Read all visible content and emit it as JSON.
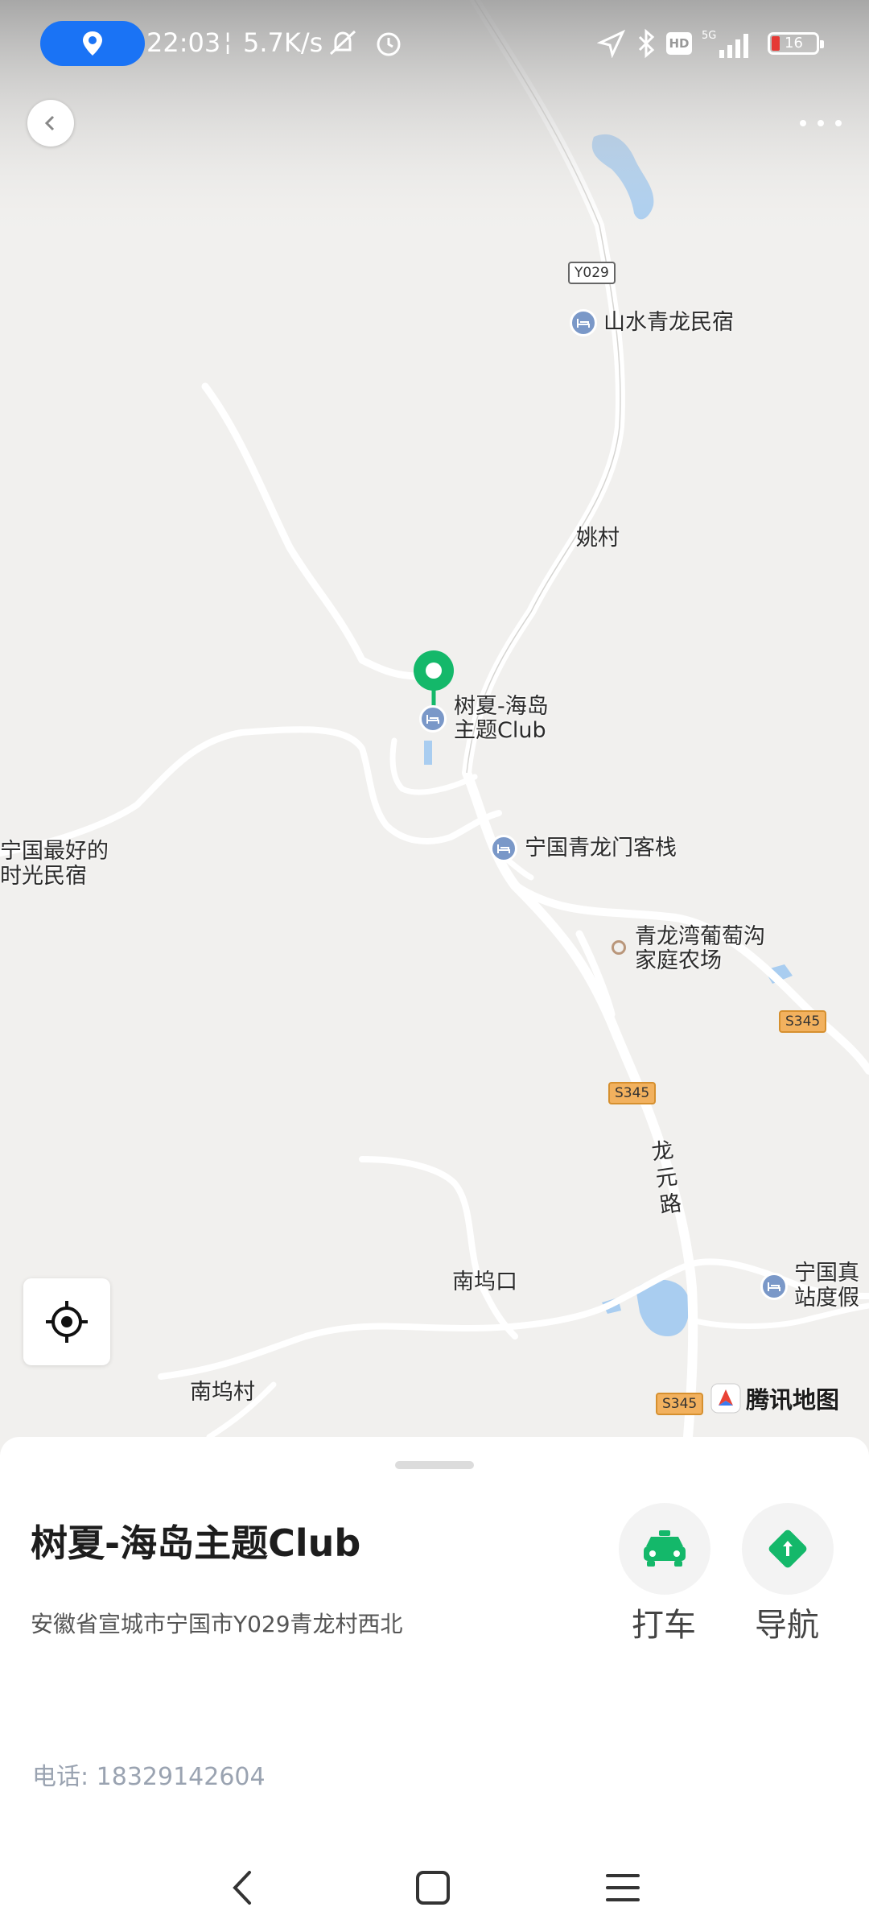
{
  "status_bar": {
    "time": "22:03",
    "net_speed": "5.7K/s",
    "battery": "16"
  },
  "map": {
    "road_codes": {
      "y029": "Y029",
      "s345": "S345"
    },
    "places": {
      "shanshui": "山水青龙民宿",
      "yaocun": "姚村",
      "selected_line1": "树夏-海岛",
      "selected_line2": "主题Club",
      "qinglongmen": "宁国青龙门客栈",
      "best_line1": "宁国最好的",
      "best_line2": "时光民宿",
      "farm_line1": "青龙湾葡萄沟",
      "farm_line2": "家庭农场",
      "longyuan_road": [
        "龙",
        "元",
        "路"
      ],
      "nanwukou": "南坞口",
      "nanwucun": "南坞村",
      "zhenshan_line1": "宁国真",
      "zhenshan_line2": "站度假"
    },
    "brand": "腾讯地图"
  },
  "sheet": {
    "title": "树夏-海岛主题Club",
    "address": "安徽省宣城市宁国市Y029青龙村西北",
    "phone": "电话: 18329142604",
    "actions": {
      "taxi_label": "打车",
      "navigate_label": "导航"
    }
  },
  "colors": {
    "accent_green": "#14b86a",
    "status_blue": "#1a73f5",
    "road_orange": "#f2b15e",
    "hotel_blue": "#7a98c8"
  },
  "icons": {
    "status": [
      "location-pin-icon",
      "mute-icon",
      "alarm-icon",
      "gps-arrow-icon",
      "bluetooth-icon",
      "hd-icon",
      "signal-icon",
      "battery-icon"
    ],
    "map": [
      "back-icon",
      "more-icon",
      "locate-icon",
      "hotel-icon",
      "farm-icon",
      "selected-pin-icon",
      "tencent-map-logo"
    ],
    "sheet": [
      "taxi-icon",
      "navigate-icon"
    ],
    "nav": [
      "nav-back-icon",
      "nav-home-icon",
      "nav-menu-icon"
    ]
  }
}
